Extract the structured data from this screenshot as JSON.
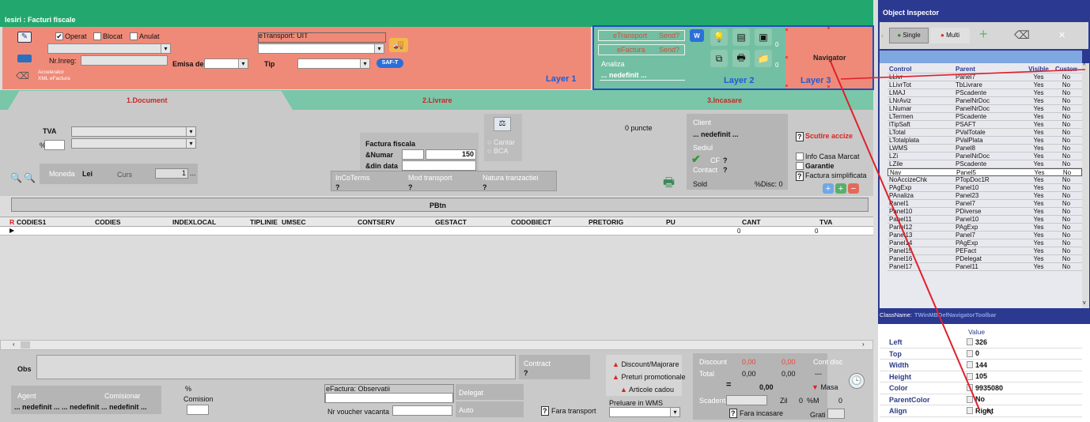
{
  "window": {
    "title": "Iesiri : Facturi fiscale"
  },
  "header": {
    "operat": "Operat",
    "blocat": "Blocat",
    "anulat": "Anulat",
    "nr_inreg": "Nr.Inreg:",
    "accelerator": "Accelerator",
    "xml_efactura": "XML eFactura",
    "emisa_de": "Emisa de",
    "etransport_uit": "eTransport: UIT",
    "tip": "Tip",
    "saft": "SAF-T",
    "layer1": "Layer 1",
    "etransport_btn": "eTransport",
    "send1": "Send?",
    "efactura_btn": "eFactura",
    "send2": "Send?",
    "analiza": "Analiza",
    "nedefinit": "... nedefinit ...",
    "layer2": "Layer 2",
    "layer3": "Layer 3",
    "navigator": "Navigator",
    "badge": "0"
  },
  "tabs": [
    {
      "label": "1.Document"
    },
    {
      "label": "2.Livrare"
    },
    {
      "label": "3.Incasare"
    }
  ],
  "document": {
    "tva": "TVA",
    "pct": "%",
    "moneda": "Moneda",
    "moneda_val": "Lei",
    "curs": "Curs",
    "curs_val": "1",
    "factura_fiscala": "Factura fiscala",
    "numar": "&Numar",
    "numar_val": "150",
    "din_data": "&din data",
    "cantar": "Cantar",
    "bca": "BCA",
    "incoterms": "InCoTerms",
    "mod_transport": "Mod transport",
    "natura": "Natura tranzactiei",
    "q": "?",
    "puncte": "0 puncte",
    "client": "Client",
    "sediul": "Sediul",
    "cf": "CF",
    "contact": "Contact",
    "sold": "Sold",
    "disc": "%Disc: 0",
    "scutire": "Scutire accize",
    "info_casa": "Info Casa Marcat",
    "garantie": "Garantie",
    "factura_simpl": "Factura simplificata"
  },
  "pbtn": "PBtn",
  "grid": {
    "r": "R",
    "columns": [
      "CODIES1",
      "CODIES",
      "INDEXLOCAL",
      "TIPLINIE",
      "UMSEC",
      "CONTSERV",
      "GESTACT",
      "CODOBIECT",
      "PRETORIG",
      "PU",
      "CANT",
      "TVA"
    ],
    "zero": "0"
  },
  "footer": {
    "obs": "Obs",
    "contract": "Contract",
    "q": "?",
    "agent": "Agent",
    "comisionar": "Comisionar",
    "pct": "%",
    "comision": "Comision",
    "agent_val": "... nedefinit ...",
    "agent_val_mid": "... nedefinit",
    "efactura_obs": "eFactura: Observatii",
    "nr_voucher": "Nr voucher vacanta",
    "delegat": "Delegat",
    "auto": "Auto",
    "fara_transport": "Fara transport",
    "discount_maj": "Discount/Majorare",
    "preturi": "Preturi promotionale",
    "articole": "Articole cadou",
    "preluare": "Preluare in WMS",
    "discount": "Discount",
    "total": "Total",
    "zero2": "0,00",
    "eq": "=",
    "scadenta": "Scadenta",
    "zil": "Zil",
    "zero": "0",
    "pct_m": "%M",
    "fara_incasare": "Fara incasare",
    "cont_disc": "Cont disc",
    "dash": "---",
    "masa": "Masa",
    "grati": "Grati"
  },
  "inspector": {
    "title": "Object Inspector",
    "single": "Single",
    "multi": "Multi",
    "headers": [
      "Control",
      "Parent",
      "Visible",
      "Custom"
    ],
    "rows": [
      [
        "LLivr",
        "Panel7",
        "Yes",
        "No"
      ],
      [
        "LLivrTot",
        "TbLivrare",
        "Yes",
        "No"
      ],
      [
        "LMAJ",
        "PScadente",
        "Yes",
        "No"
      ],
      [
        "LNrAviz",
        "PanelNrDoc",
        "Yes",
        "No"
      ],
      [
        "LNumar",
        "PanelNrDoc",
        "Yes",
        "No"
      ],
      [
        "LTermen",
        "PScadente",
        "Yes",
        "No"
      ],
      [
        "lTipSaft",
        "PSAFT",
        "Yes",
        "No"
      ],
      [
        "LTotal",
        "PValTotale",
        "Yes",
        "No"
      ],
      [
        "LTotalplata",
        "PValPlata",
        "Yes",
        "No"
      ],
      [
        "LWMS",
        "Panel8",
        "Yes",
        "No"
      ],
      [
        "LZi",
        "PanelNrDoc",
        "Yes",
        "No"
      ],
      [
        "LZile",
        "PScadente",
        "Yes",
        "No"
      ],
      [
        "Nav",
        "Panel5",
        "Yes",
        "No"
      ],
      [
        "NoAccizeChk",
        "PTopDoc1R",
        "Yes",
        "No"
      ],
      [
        "PAgExp",
        "Panel10",
        "Yes",
        "No"
      ],
      [
        "PAnaliza",
        "Panel23",
        "Yes",
        "No"
      ],
      [
        "Panel1",
        "Panel7",
        "Yes",
        "No"
      ],
      [
        "Panel10",
        "PDiverse",
        "Yes",
        "No"
      ],
      [
        "Panel11",
        "Panel10",
        "Yes",
        "No"
      ],
      [
        "Panel12",
        "PAgExp",
        "Yes",
        "No"
      ],
      [
        "Panel13",
        "Panel7",
        "Yes",
        "No"
      ],
      [
        "Panel14",
        "PAgExp",
        "Yes",
        "No"
      ],
      [
        "Panel15",
        "PEFact",
        "Yes",
        "No"
      ],
      [
        "Panel16",
        "PDelegat",
        "Yes",
        "No"
      ],
      [
        "Panel17",
        "Panel11",
        "Yes",
        "No"
      ]
    ],
    "classname_label": "ClassName:",
    "classname_val": "TWinMBDefNavigatorToolbar",
    "value_header": "Value",
    "props": [
      [
        "Left",
        "326"
      ],
      [
        "Top",
        "0"
      ],
      [
        "Width",
        "144"
      ],
      [
        "Height",
        "105"
      ],
      [
        "Color",
        "9935080"
      ],
      [
        "ParentColor",
        "No"
      ],
      [
        "Align",
        "Right"
      ]
    ]
  },
  "colors": {
    "salmon": "#f08a78",
    "teal": "#7cc8ab",
    "inspector": "#2b3990",
    "highlight": "#1e5bd8"
  }
}
